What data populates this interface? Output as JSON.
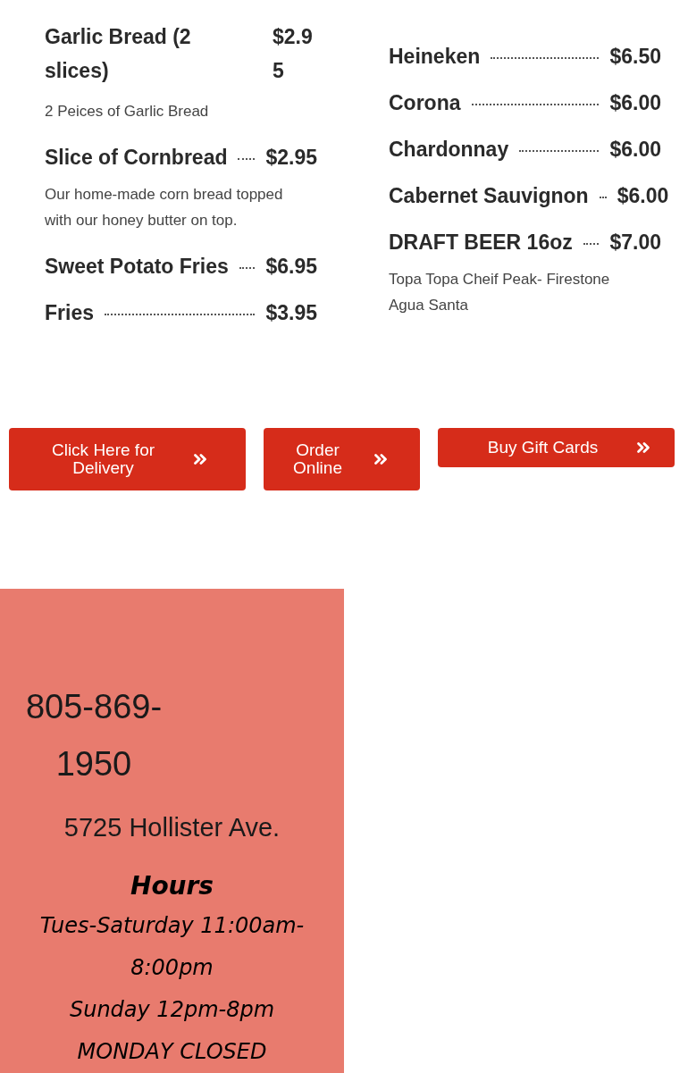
{
  "menu_columns": [
    {
      "items": [
        {
          "name": "Garlic Bread (2 slices)",
          "price": "$2.95",
          "description": "2 Peices of Garlic Bread",
          "kind": "narrow"
        },
        {
          "name": "Slice of Cornbread",
          "price": "$2.95",
          "description": "Our home-made corn bread topped with our honey butter on top.",
          "kind": "leader"
        },
        {
          "name": "Sweet Potato Fries",
          "price": "$6.95",
          "kind": "leader"
        },
        {
          "name": "Fries",
          "price": "$3.95",
          "kind": "leader"
        }
      ]
    },
    {
      "items": [
        {
          "name": "Heineken",
          "price": "$6.50",
          "kind": "leader"
        },
        {
          "name": "Corona",
          "price": "$6.00",
          "kind": "leader"
        },
        {
          "name": "Chardonnay",
          "price": "$6.00",
          "kind": "leader"
        },
        {
          "name": "Cabernet Sauvignon",
          "price": "$6.00",
          "kind": "leader"
        },
        {
          "name": "DRAFT BEER 16oz",
          "price": "$7.00",
          "description": "Topa Topa Cheif Peak- Firestone Agua Santa",
          "kind": "leader"
        }
      ]
    }
  ],
  "buttons": [
    {
      "label": "Click Here for Delivery"
    },
    {
      "label": "Order Online"
    },
    {
      "label": "Buy Gift Cards"
    }
  ],
  "contact": {
    "phone": "805-869-1950",
    "address": "5725 Hollister Ave.",
    "hours_title": "Hours",
    "hours": [
      "Tues-Saturday 11:00am-8:00pm",
      "Sunday 12pm-8pm",
      "MONDAY CLOSED"
    ]
  }
}
